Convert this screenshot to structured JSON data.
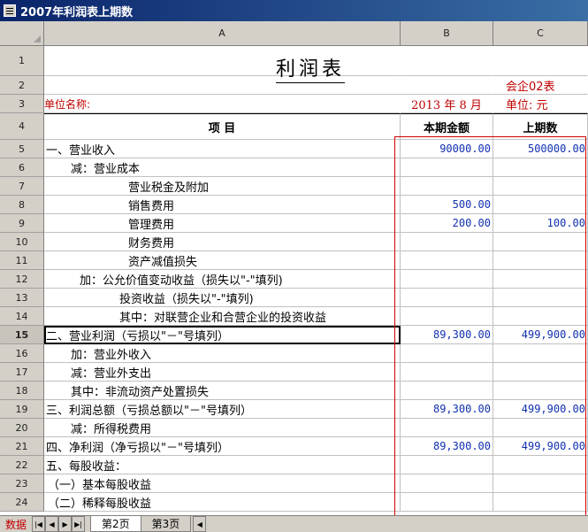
{
  "window": {
    "title": "2007年利润表上期数"
  },
  "columns": [
    "A",
    "B",
    "C"
  ],
  "row_numbers": [
    "1",
    "2",
    "3",
    "4",
    "5",
    "6",
    "7",
    "8",
    "9",
    "10",
    "11",
    "12",
    "13",
    "14",
    "15",
    "16",
    "17",
    "18",
    "19",
    "20",
    "21",
    "22",
    "23",
    "24"
  ],
  "sheet": {
    "title": "利润表",
    "form_code": "会企02表",
    "company_label": "单位名称:",
    "date_text": "2013 年  8 月",
    "unit_text": "单位: 元",
    "header_item": "项          目",
    "header_current": "本期金额",
    "header_prior": "上期数"
  },
  "rows": [
    {
      "label": "一、营业收入",
      "current": "90000.00",
      "prior": "500000.00"
    },
    {
      "label": "减：营业成本",
      "current": "",
      "prior": ""
    },
    {
      "label": "营业税金及附加",
      "current": "",
      "prior": ""
    },
    {
      "label": "销售费用",
      "current": "500.00",
      "prior": ""
    },
    {
      "label": "管理费用",
      "current": "200.00",
      "prior": "100.00"
    },
    {
      "label": "财务费用",
      "current": "",
      "prior": ""
    },
    {
      "label": "资产减值损失",
      "current": "",
      "prior": ""
    },
    {
      "label": "加：公允价值变动收益（损失以\"-\"填列)",
      "current": "",
      "prior": ""
    },
    {
      "label": "投资收益（损失以\"-\"填列)",
      "current": "",
      "prior": ""
    },
    {
      "label": "其中：对联营企业和合营企业的投资收益",
      "current": "",
      "prior": ""
    },
    {
      "label": "二、营业利润（亏损以\"－\"号填列）",
      "current": "89,300.00",
      "prior": "499,900.00"
    },
    {
      "label": "加：营业外收入",
      "current": "",
      "prior": ""
    },
    {
      "label": "减：营业外支出",
      "current": "",
      "prior": ""
    },
    {
      "label": "其中：非流动资产处置损失",
      "current": "",
      "prior": ""
    },
    {
      "label": "三、利润总额（亏损总额以\"－\"号填列）",
      "current": "89,300.00",
      "prior": "499,900.00"
    },
    {
      "label": "减：所得税费用",
      "current": "",
      "prior": ""
    },
    {
      "label": "四、净利润（净亏损以\"－\"号填列）",
      "current": "89,300.00",
      "prior": "499,900.00"
    },
    {
      "label": "五、每股收益：",
      "current": "",
      "prior": ""
    },
    {
      "label": "（一）基本每股收益",
      "current": "",
      "prior": ""
    },
    {
      "label": "（二）稀释每股收益",
      "current": "",
      "prior": ""
    }
  ],
  "tabs": {
    "left_label": "数据",
    "sheets": [
      "第2页",
      "第3页"
    ]
  }
}
